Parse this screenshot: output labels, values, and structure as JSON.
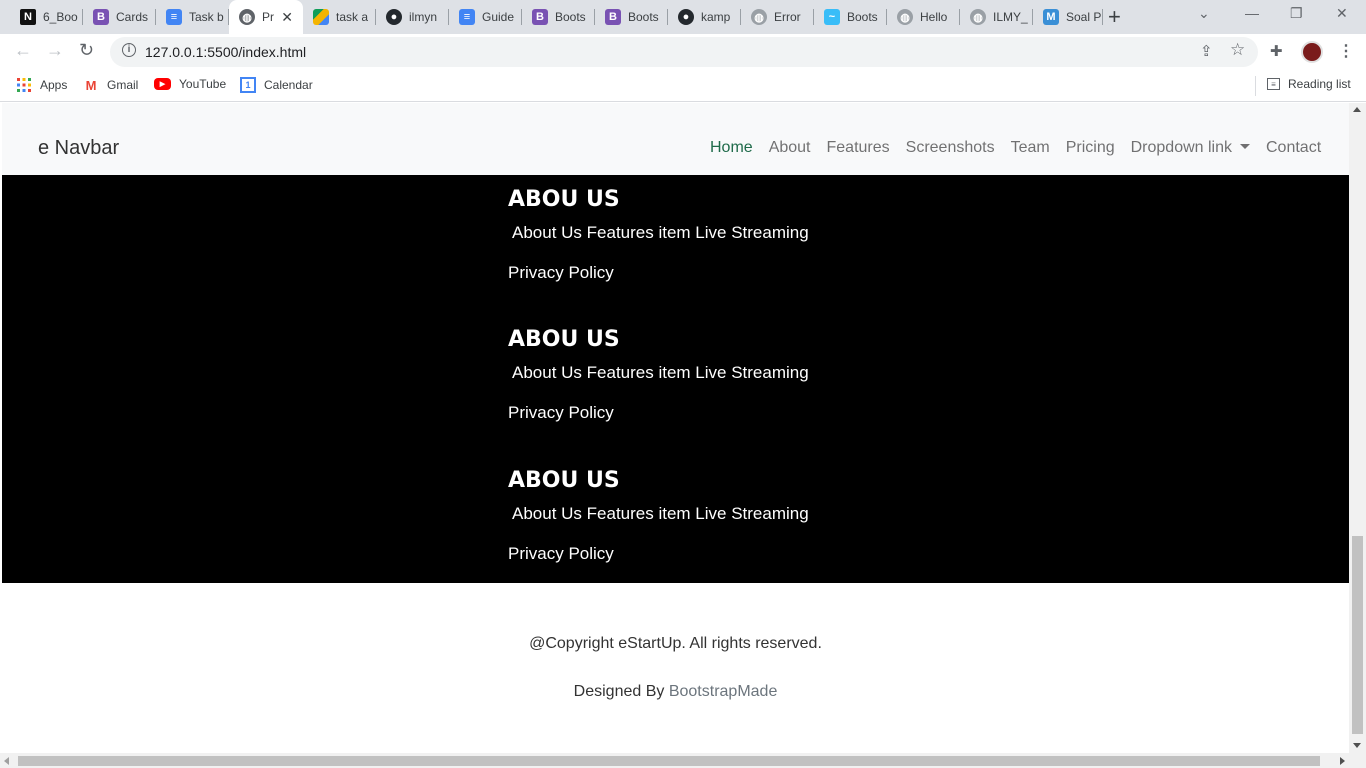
{
  "browser": {
    "tabs": [
      {
        "title": "6_Boo",
        "icon": "notion-icon",
        "active": false
      },
      {
        "title": "Cards",
        "icon": "bootstrap-icon",
        "active": false
      },
      {
        "title": "Task b",
        "icon": "google-docs-icon",
        "active": false
      },
      {
        "title": "Pr",
        "icon": "globe-icon",
        "active": true
      },
      {
        "title": "task a",
        "icon": "google-drive-icon",
        "active": false
      },
      {
        "title": "ilmyn",
        "icon": "github-icon",
        "active": false
      },
      {
        "title": "Guide",
        "icon": "google-docs-icon",
        "active": false
      },
      {
        "title": "Boots",
        "icon": "bootstrap-icon",
        "active": false
      },
      {
        "title": "Boots",
        "icon": "bootstrap-icon",
        "active": false
      },
      {
        "title": "kamp",
        "icon": "github-icon",
        "active": false
      },
      {
        "title": "Error",
        "icon": "globe-icon",
        "active": false
      },
      {
        "title": "Boots",
        "icon": "tailwind-icon",
        "active": false
      },
      {
        "title": "Hello",
        "icon": "globe-icon",
        "active": false
      },
      {
        "title": "ILMY_",
        "icon": "globe-icon",
        "active": false
      },
      {
        "title": "Soal P",
        "icon": "m-icon",
        "active": false
      }
    ],
    "url": "127.0.0.1:5500/index.html",
    "bookmarks": [
      {
        "label": "Apps",
        "icon": "apps-grid-icon"
      },
      {
        "label": "Gmail",
        "icon": "gmail-icon"
      },
      {
        "label": "YouTube",
        "icon": "youtube-icon"
      },
      {
        "label": "Calendar",
        "icon": "calendar-icon"
      }
    ],
    "reading_list": "Reading list"
  },
  "navbar": {
    "brand": "e Navbar",
    "links": [
      {
        "label": "Home",
        "active": true
      },
      {
        "label": "About"
      },
      {
        "label": "Features"
      },
      {
        "label": "Screenshots"
      },
      {
        "label": "Team"
      },
      {
        "label": "Pricing"
      },
      {
        "label": "Dropdown link",
        "dropdown": true
      },
      {
        "label": "Contact"
      }
    ]
  },
  "sections": [
    {
      "title": "ABOU US",
      "links": "About Us Features item Live Streaming",
      "policy": "Privacy Policy"
    },
    {
      "title": "ABOU US",
      "links": "About Us Features item Live Streaming",
      "policy": "Privacy Policy"
    },
    {
      "title": "ABOU US",
      "links": "About Us Features item Live Streaming",
      "policy": "Privacy Policy"
    }
  ],
  "footer": {
    "copyright": "@Copyright eStartUp. All rights reserved.",
    "designed_by": "Designed By",
    "designer": "BootstrapMade"
  }
}
